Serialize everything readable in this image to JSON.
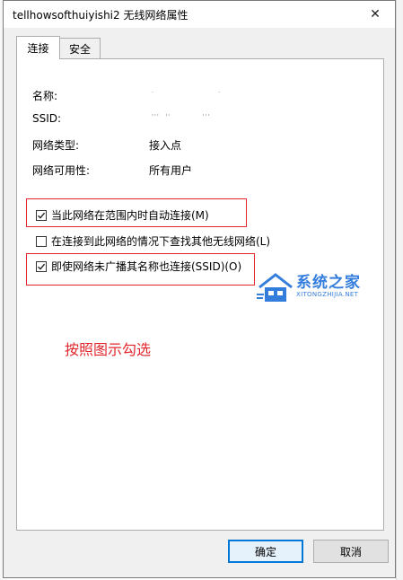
{
  "dialog": {
    "title": "tellhowsofthuiyishi2 无线网络属性",
    "close_glyph": "✕"
  },
  "tabs": [
    {
      "label": "连接",
      "active": true
    },
    {
      "label": "安全",
      "active": false
    }
  ],
  "properties": [
    {
      "label": "名称:",
      "value": ""
    },
    {
      "label": "SSID:",
      "value": ""
    },
    {
      "label": "网络类型:",
      "value": "接入点"
    },
    {
      "label": "网络可用性:",
      "value": "所有用户"
    }
  ],
  "options": [
    {
      "label": "当此网络在范围内时自动连接(M)",
      "checked": true,
      "highlighted": true
    },
    {
      "label": "在连接到此网络的情况下查找其他无线网络(L)",
      "checked": false,
      "highlighted": false
    },
    {
      "label": "即使网络未广播其名称也连接(SSID)(O)",
      "checked": true,
      "highlighted": true
    }
  ],
  "annotation": {
    "text": "按照图示勾选",
    "color": "#e1262d"
  },
  "watermark": {
    "name": "系统之家",
    "url": "XITONGZHIJIA.NET",
    "color": "#1e6fd9"
  },
  "buttons": {
    "ok_label": "确定",
    "cancel_label": "取消"
  },
  "colors": {
    "accent": "#0078d7",
    "highlight_box": "#e1262d"
  }
}
